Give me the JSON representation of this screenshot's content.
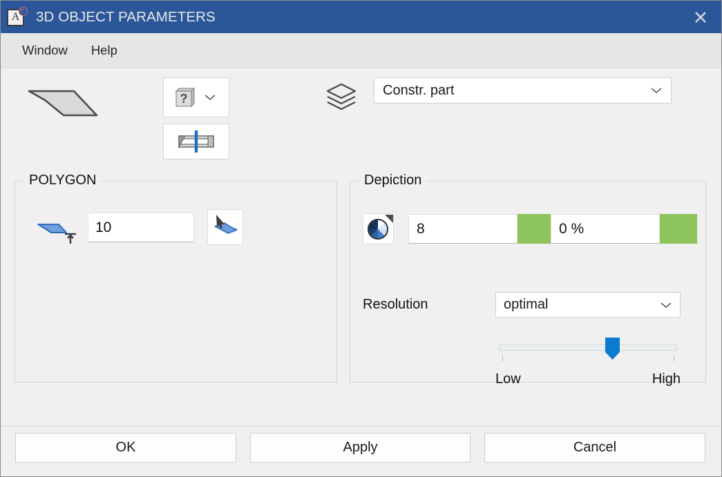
{
  "window": {
    "title": "3D OBJECT PARAMETERS",
    "app_icon": "a-letter-document-icon",
    "close_icon": "close-icon",
    "titlebar_color": "#2b579a",
    "background_color": "#f0f0f0"
  },
  "menubar": {
    "items": [
      {
        "label": "Window"
      },
      {
        "label": "Help"
      }
    ]
  },
  "toolbar": {
    "shape_preview_icon": "flat-polygon-preview-icon",
    "help_button": {
      "icon": "question-book-icon",
      "dropdown_icon": "chevron-down-icon"
    },
    "section_button": {
      "icon": "section-cut-beam-icon"
    },
    "layers_icon": "layers-stack-icon",
    "layer_combo": {
      "value": "Constr. part",
      "dropdown_icon": "chevron-down-icon"
    }
  },
  "polygon_group": {
    "title": "POLYGON",
    "thickness_icon": "polygon-height-icon",
    "thickness_value": "10",
    "pick_button_icon": "pick-polygon-cursor-icon"
  },
  "depiction_group": {
    "title": "Depiction",
    "color_wheel_icon": "color-wheel-icon",
    "color_count_value": "8",
    "color_swatch": "#8dc45c",
    "transparency_value": "0 %",
    "transparency_swatch": "#8dc45c",
    "resolution": {
      "label": "Resolution",
      "value": "optimal",
      "dropdown_icon": "chevron-down-icon"
    },
    "slider": {
      "low_label": "Low",
      "high_label": "High",
      "position_percent": 65,
      "handle_color": "#0b7ad1"
    }
  },
  "footer": {
    "ok_label": "OK",
    "apply_label": "Apply",
    "cancel_label": "Cancel"
  }
}
